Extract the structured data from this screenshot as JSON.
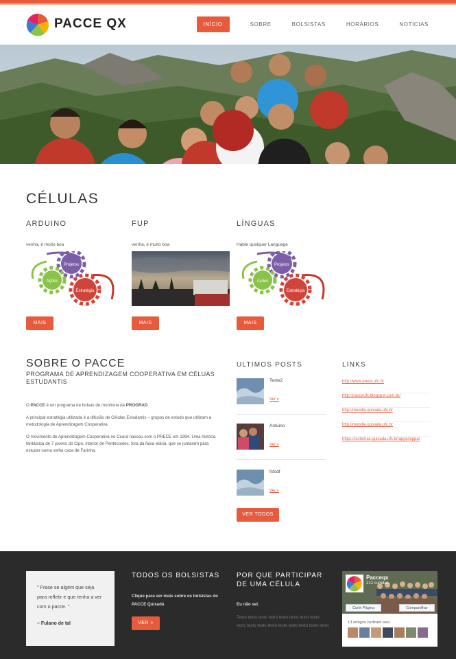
{
  "site": {
    "brand": "PACCE QX"
  },
  "nav": {
    "items": [
      "INÍCIO",
      "SOBRE",
      "BOLSISTAS",
      "HORÁRIOS",
      "NOTÍCIAS"
    ],
    "active": "INÍCIO"
  },
  "celulas": {
    "title": "CÉLULAS",
    "items": [
      {
        "title": "ARDUINO",
        "desc": "venha, é muito boa",
        "image": "diagram-projetos-acoes-estrategia",
        "button": "MAIS"
      },
      {
        "title": "FUP",
        "desc": "venha, é muito boa",
        "image": "sunset-photo",
        "button": "MAIS"
      },
      {
        "title": "LÍNGUAS",
        "desc": "Hable qualquer Language",
        "image": "diagram-projetos-acoes-estrategia",
        "button": "MAIS"
      }
    ],
    "diagram_labels": [
      "Projetos",
      "Ações",
      "Estratégia"
    ]
  },
  "about": {
    "title": "SOBRE O PACCE",
    "subtitle": "PROGRAMA DE APRENDIZAGEM COOPERATIVA EM CÉLUAS ESTUDANTIS",
    "p1_pre": "O ",
    "p1_b1": "PACCE",
    "p1_mid": " é um programa de bolsas de monitoria da ",
    "p1_b2": "PROGRAD",
    "p2": "A principal estratégia utilizada é a difusão de Células Estudantis – grupos de estudo que utilizam a metodologia de Aprendizagem Cooperativa.",
    "p3": "O movimento de Aprendizagem Cooperativa no Ceará nasceu com o PRECE em 1994. Uma história fantástica de 7 jovens do Cipó, interior de Pentecostes, fora da faixa etária, que se juntaram para estudar numa velha casa de Farinha."
  },
  "posts": {
    "title": "ULTIMOS POSTS",
    "items": [
      {
        "title": "Teste2",
        "more": "Ver »"
      },
      {
        "title": "Arduino",
        "more": "Ver »"
      },
      {
        "title": "fsfsdf",
        "more": "Ver »"
      }
    ],
    "button": "VER TODOS"
  },
  "links": {
    "title": "LINKS",
    "items": [
      "http://www.prece.ufc.br",
      "http://pacceufc.blogspot.com.br/",
      "http://moodle.quixada.ufc.br",
      "http://moodle.quixada.ufc.br",
      "https://sistemas.quixada.ufc.br/apps/sippa/"
    ]
  },
  "footer": {
    "quote": "\" Frase se algém que seja para refletir e que tenha a ver com o pacce. \"",
    "quote_author": "– Fulano de tal",
    "bolsistas": {
      "title": "TODOS OS BOLSISTAS",
      "text": "Clique para ver mais sobre os bolsistas do PACCE Quixadá",
      "button": "VER »"
    },
    "participar": {
      "title": "POR QUE PARTICIPAR DE UMA CÉLULA",
      "subtitle": "Eu não sei.",
      "text": "Texto texto texto texto texto texto texto texto texto texto texto texto texto texto texto texto texto"
    },
    "facebook": {
      "page_name": "Pacceqx",
      "likes": "212 curtidas",
      "like_button": "Curtir Página",
      "share_button": "Compartilhar",
      "friends": "13 amigos curtiram isso."
    }
  },
  "colors": {
    "accent": "#e85a3c",
    "footer_bg": "#2b2b2b"
  }
}
